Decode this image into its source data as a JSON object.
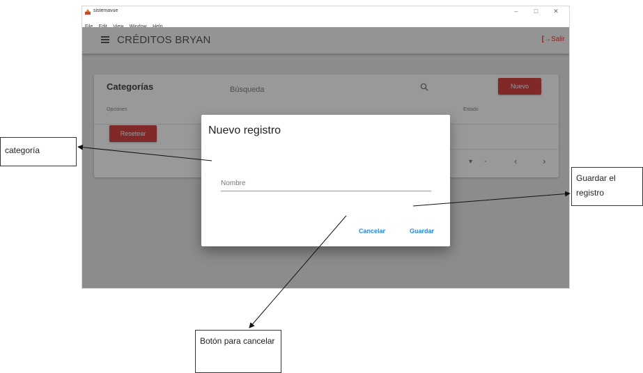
{
  "window": {
    "title": "sistemavue",
    "controls": {
      "minimize": "–",
      "maximize": "□",
      "close": "✕"
    },
    "menu": [
      "File",
      "Edit",
      "View",
      "Window",
      "Help"
    ]
  },
  "toolbar": {
    "title": "CRÉDITOS BRYAN",
    "logout_label": "Salir"
  },
  "card": {
    "title": "Categorías",
    "search_placeholder": "Búsqueda",
    "new_button": "Nuevo",
    "column_headers": [
      "Opciones",
      "Estado"
    ],
    "reset_button": "Resetear",
    "pager": {
      "dash": "-",
      "prev": "‹",
      "next": "›",
      "dropdown": "▾"
    }
  },
  "dialog": {
    "title": "Nuevo registro",
    "name_placeholder": "Nombre",
    "cancel_label": "Cancelar",
    "save_label": "Guardar"
  },
  "annotations": {
    "category": "categoría",
    "save": "Guardar el registro",
    "cancel": "Botón para cancelar"
  },
  "colors": {
    "primary_red": "#d32f2f",
    "link_blue": "#1e88e5"
  }
}
